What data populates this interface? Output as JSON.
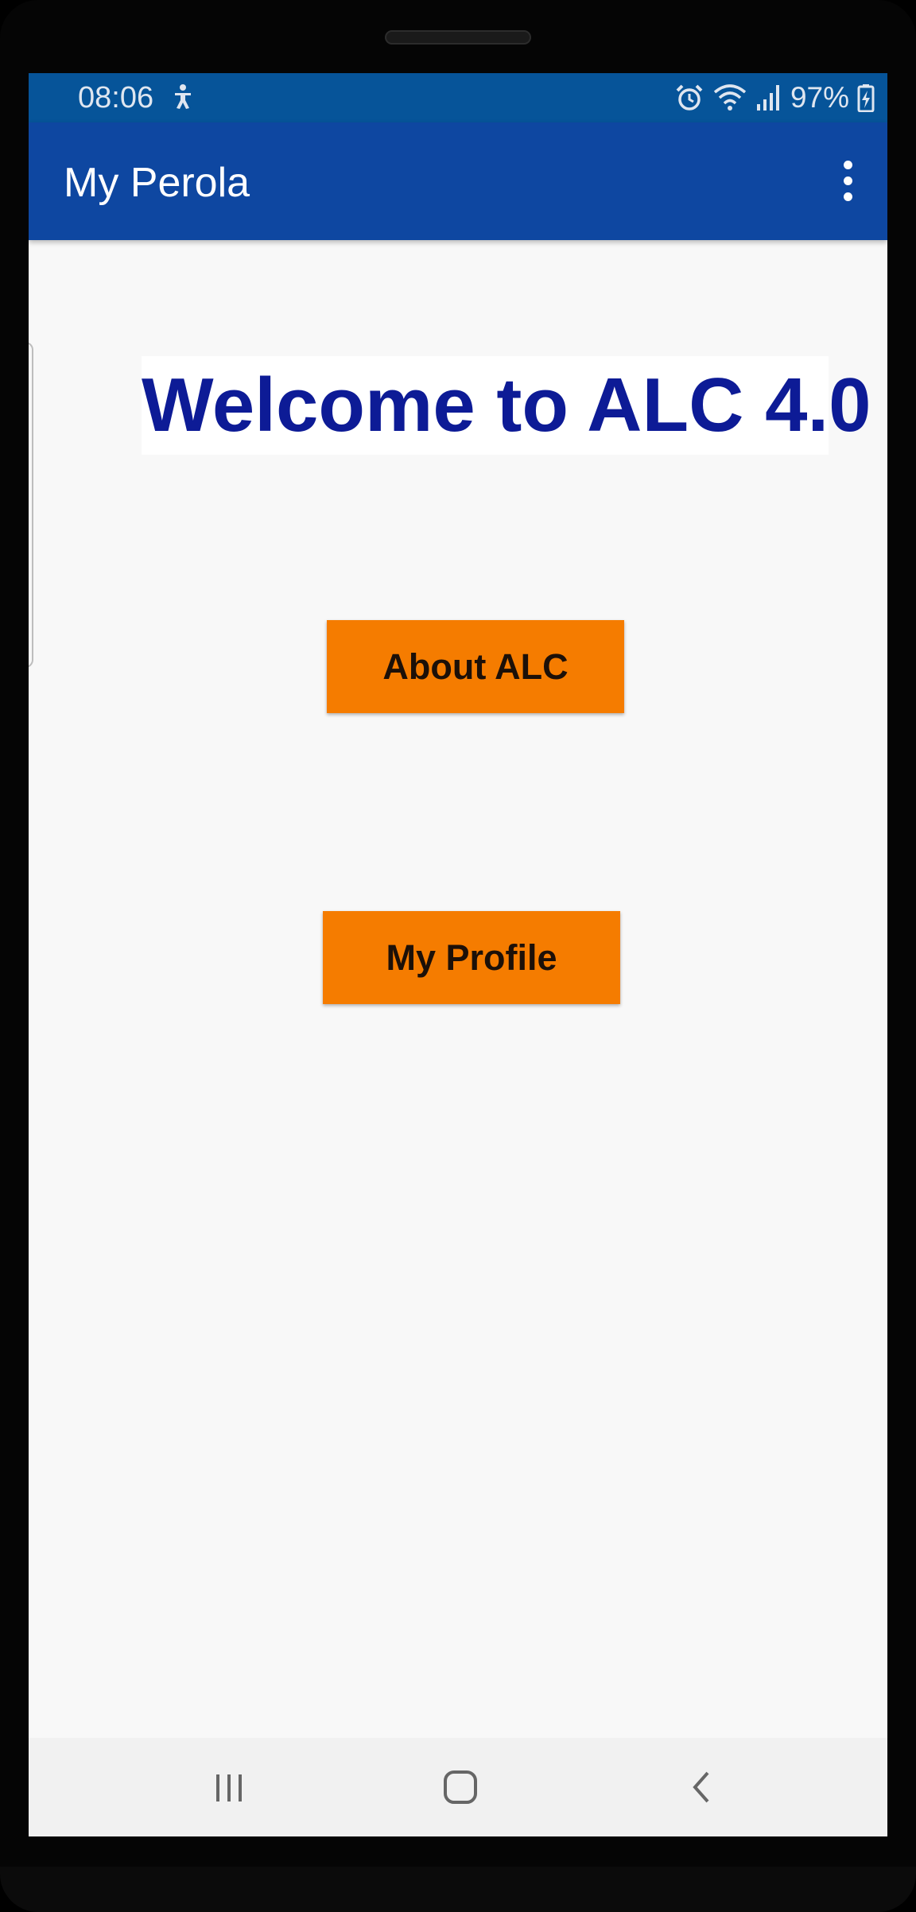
{
  "status_bar": {
    "time": "08:06",
    "battery_percent": "97%",
    "icons": [
      "accessibility-icon",
      "alarm-icon",
      "wifi-icon",
      "signal-icon",
      "battery-charging-icon"
    ],
    "background": "#065499"
  },
  "app_bar": {
    "title": "My Perola",
    "menu_icon": "overflow-menu-icon",
    "background": "#0e47a1"
  },
  "main": {
    "welcome_text": "Welcome to ALC 4.0",
    "welcome_color": "#0d1b96",
    "buttons": [
      {
        "label": "About ALC",
        "color": "#f57c00"
      },
      {
        "label": "My Profile",
        "color": "#f57c00"
      }
    ]
  },
  "nav_bar": {
    "items": [
      "recents-icon",
      "home-icon",
      "back-icon"
    ]
  }
}
